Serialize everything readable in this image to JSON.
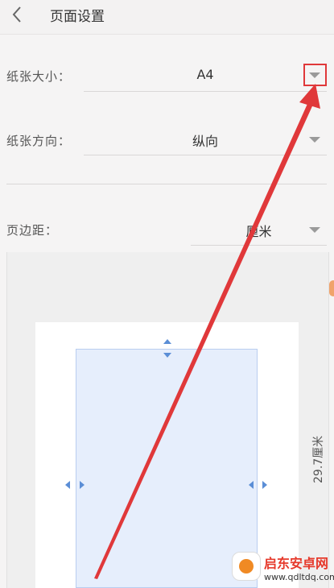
{
  "header": {
    "title": "页面设置",
    "back_icon": "chevron-left-icon"
  },
  "paper_size": {
    "label": "纸张大小：",
    "value": "A4"
  },
  "orientation": {
    "label": "纸张方向：",
    "value": "纵向"
  },
  "margins": {
    "label": "页边距：",
    "unit": "厘米"
  },
  "preview": {
    "height_label": "29.7厘米"
  },
  "annotation": {
    "color": "#e0383a"
  },
  "watermark": {
    "title": "启东安卓网",
    "url": "www.qdltdq.com"
  }
}
